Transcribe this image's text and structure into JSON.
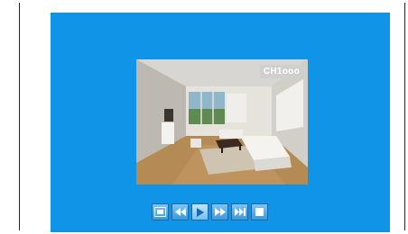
{
  "player": {
    "channel_label": "CH1ooo"
  },
  "controls": [
    {
      "name": "snapshot-button",
      "icon": "snapshot-icon"
    },
    {
      "name": "rewind-button",
      "icon": "rewind-icon"
    },
    {
      "name": "play-button",
      "icon": "play-icon",
      "state": "active"
    },
    {
      "name": "fast-forward-button",
      "icon": "fast-forward-icon"
    },
    {
      "name": "skip-to-end-button",
      "icon": "skip-to-end-icon"
    },
    {
      "name": "stop-button",
      "icon": "stop-icon"
    }
  ],
  "colors": {
    "screen_background": "#0f94e8",
    "control_fill": "#5ab0ea",
    "icon_color": "#ffffff"
  }
}
